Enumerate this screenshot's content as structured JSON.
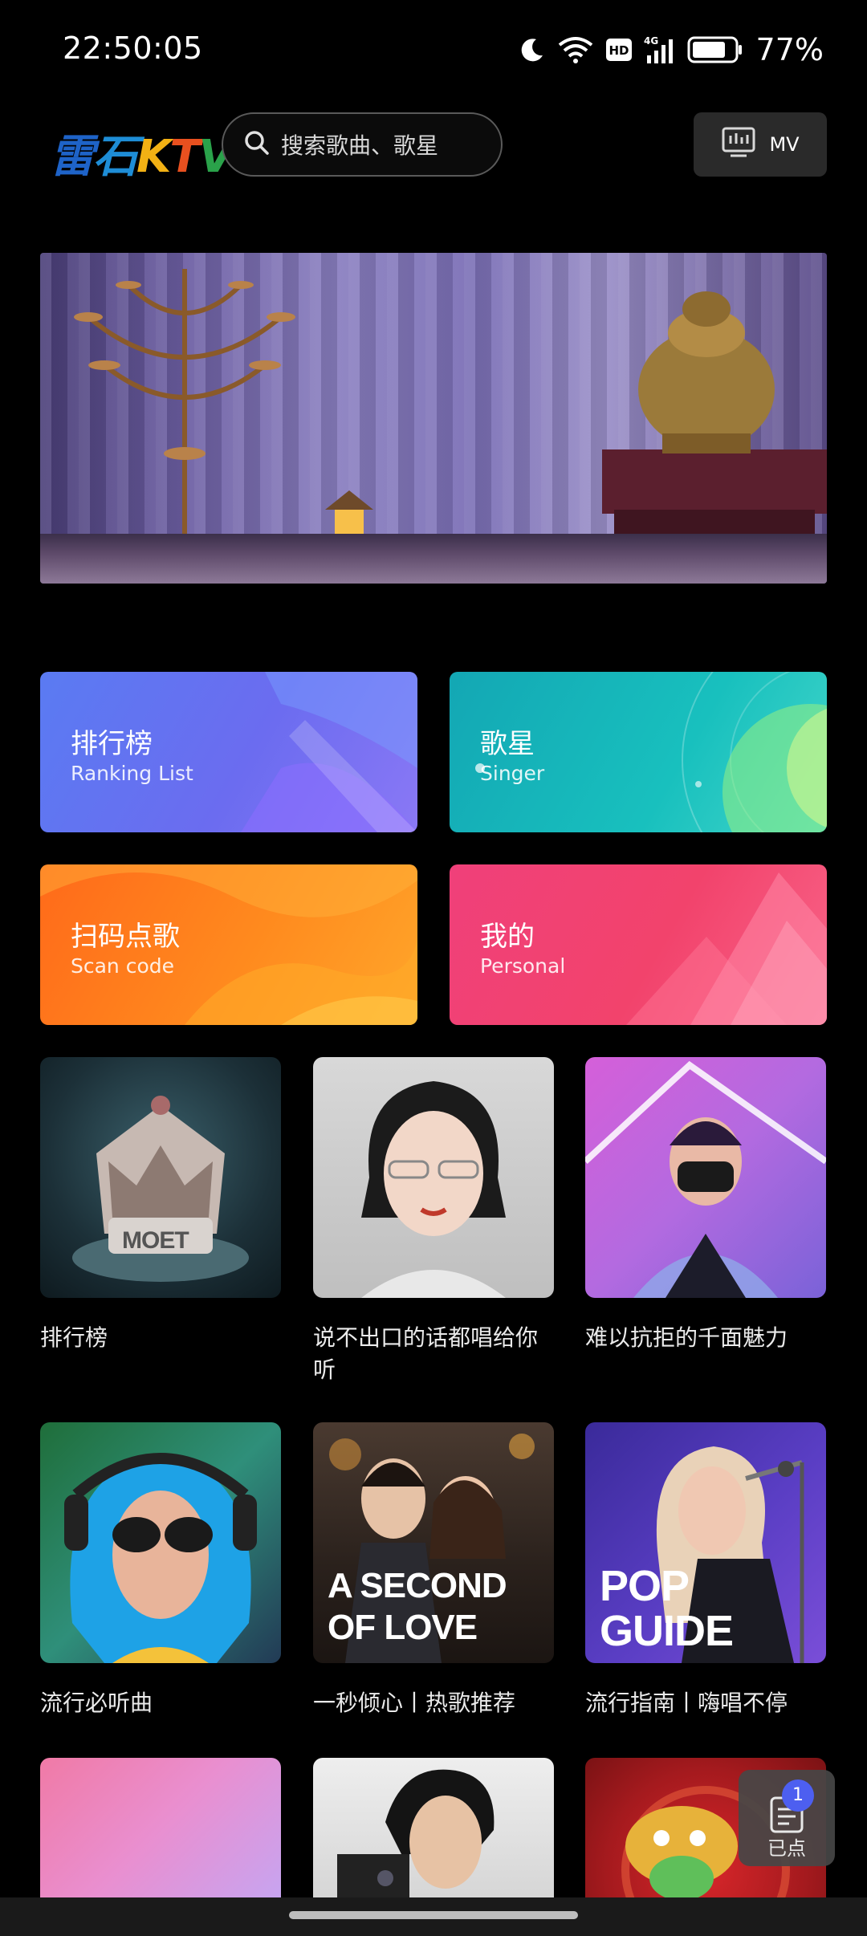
{
  "status_bar": {
    "time": "22:50:05",
    "battery_percent": "77%",
    "network_badge": "HD",
    "signal_label": "4G",
    "icons": [
      "moon-icon",
      "wifi-icon",
      "hd-icon",
      "signal-4g-icon",
      "battery-icon"
    ]
  },
  "header": {
    "logo_text": "雷石KTV",
    "search_placeholder": "搜索歌曲、歌星",
    "mv_label": "MV"
  },
  "categories": [
    {
      "title": "排行榜",
      "subtitle": "Ranking List"
    },
    {
      "title": "歌星",
      "subtitle": "Singer"
    },
    {
      "title": "扫码点歌",
      "subtitle": "Scan code"
    },
    {
      "title": "我的",
      "subtitle": "Personal"
    }
  ],
  "playlists": [
    {
      "label": "排行榜",
      "thumb_text": "MOET"
    },
    {
      "label": "说不出口的话都唱给你听"
    },
    {
      "label": "难以抗拒的千面魅力"
    },
    {
      "label": "流行必听曲"
    },
    {
      "label": "一秒倾心丨热歌推荐",
      "thumb_text": "A SECOND OF LOVE"
    },
    {
      "label": "流行指南丨嗨唱不停",
      "thumb_text": "POP GUIDE"
    }
  ],
  "queue": {
    "label": "已点",
    "count": "1"
  },
  "colors": {
    "background": "#000000",
    "ranking": "#6b6cf0",
    "singer": "#18c0be",
    "scan": "#ff8a1e",
    "personal": "#f2436c",
    "badge": "#4d5ff0"
  }
}
